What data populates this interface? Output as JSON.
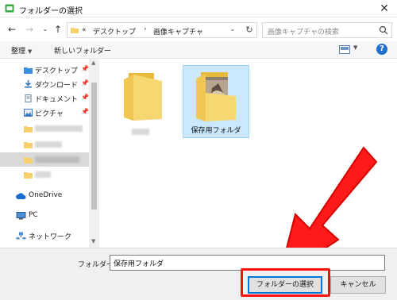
{
  "window": {
    "title": "フォルダーの選択"
  },
  "address": {
    "overflow": "«",
    "crumbs": [
      "デスクトップ",
      "画像キャプチャ"
    ]
  },
  "search": {
    "placeholder": "画像キャプチャの検索"
  },
  "toolbar": {
    "organize": "整理",
    "new_folder": "新しいフォルダー",
    "help": "?"
  },
  "nav": {
    "quick_access": [
      {
        "label": "デスクトップ",
        "icon": "desktop-folder-icon"
      },
      {
        "label": "ダウンロード",
        "icon": "download-icon"
      },
      {
        "label": "ドキュメント",
        "icon": "documents-icon"
      },
      {
        "label": "ピクチャ",
        "icon": "pictures-icon"
      }
    ],
    "onedrive": "OneDrive",
    "pc": "PC",
    "network": "ネットワーク"
  },
  "content": {
    "items": [
      {
        "label": "",
        "type": "folder"
      },
      {
        "label": "保存用フォルダ",
        "type": "folder-with-photos"
      }
    ]
  },
  "footer": {
    "folder_label": "フォルダー:",
    "folder_value": "保存用フォルダ",
    "select_button": "フォルダーの選択",
    "cancel_button": "キャンセル"
  },
  "colors": {
    "accent": "#0078d7",
    "annotation": "#ff1010",
    "folder": "#f6d16b"
  }
}
